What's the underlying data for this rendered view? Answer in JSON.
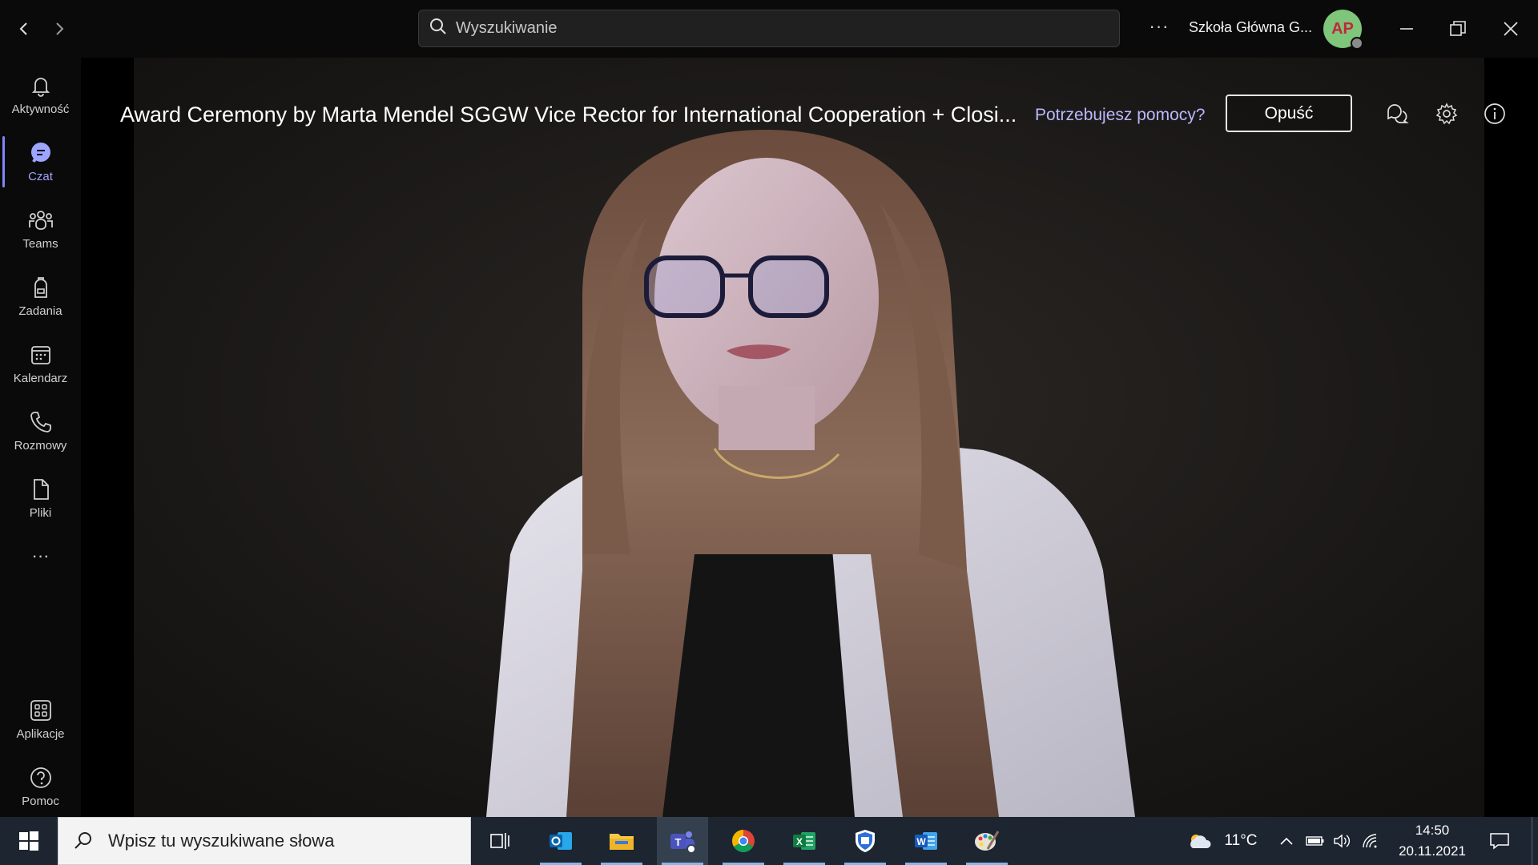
{
  "titlebar": {
    "search_placeholder": "Wyszukiwanie",
    "more_label": "···",
    "org_name": "Szkoła Główna G...",
    "avatar_initials": "AP"
  },
  "rail": {
    "items": [
      {
        "label": "Aktywność",
        "icon": "bell-icon"
      },
      {
        "label": "Czat",
        "icon": "chat-icon",
        "active": true
      },
      {
        "label": "Teams",
        "icon": "teams-icon"
      },
      {
        "label": "Zadania",
        "icon": "backpack-icon"
      },
      {
        "label": "Kalendarz",
        "icon": "calendar-icon"
      },
      {
        "label": "Rozmowy",
        "icon": "phone-icon"
      },
      {
        "label": "Pliki",
        "icon": "file-icon"
      }
    ],
    "more_label": "···",
    "bottom_items": [
      {
        "label": "Aplikacje",
        "icon": "apps-icon"
      },
      {
        "label": "Pomoc",
        "icon": "help-icon"
      }
    ]
  },
  "meeting": {
    "title": "Award Ceremony by Marta Mendel SGGW Vice Rector for International Cooperation + Closi...",
    "help_link": "Potrzebujesz pomocy?",
    "leave_label": "Opuść"
  },
  "taskbar": {
    "search_placeholder": "Wpisz tu wyszukiwane słowa",
    "apps": [
      "task-view-icon",
      "outlook-icon",
      "file-explorer-icon",
      "teams-icon",
      "chrome-icon",
      "excel-icon",
      "defender-icon",
      "word-icon",
      "paint-icon"
    ],
    "weather_temp": "11°C",
    "time": "14:50",
    "date": "20.11.2021"
  },
  "colors": {
    "accent": "#7f85f5",
    "link": "#b9b9ff",
    "taskbar": "#1c2530"
  }
}
